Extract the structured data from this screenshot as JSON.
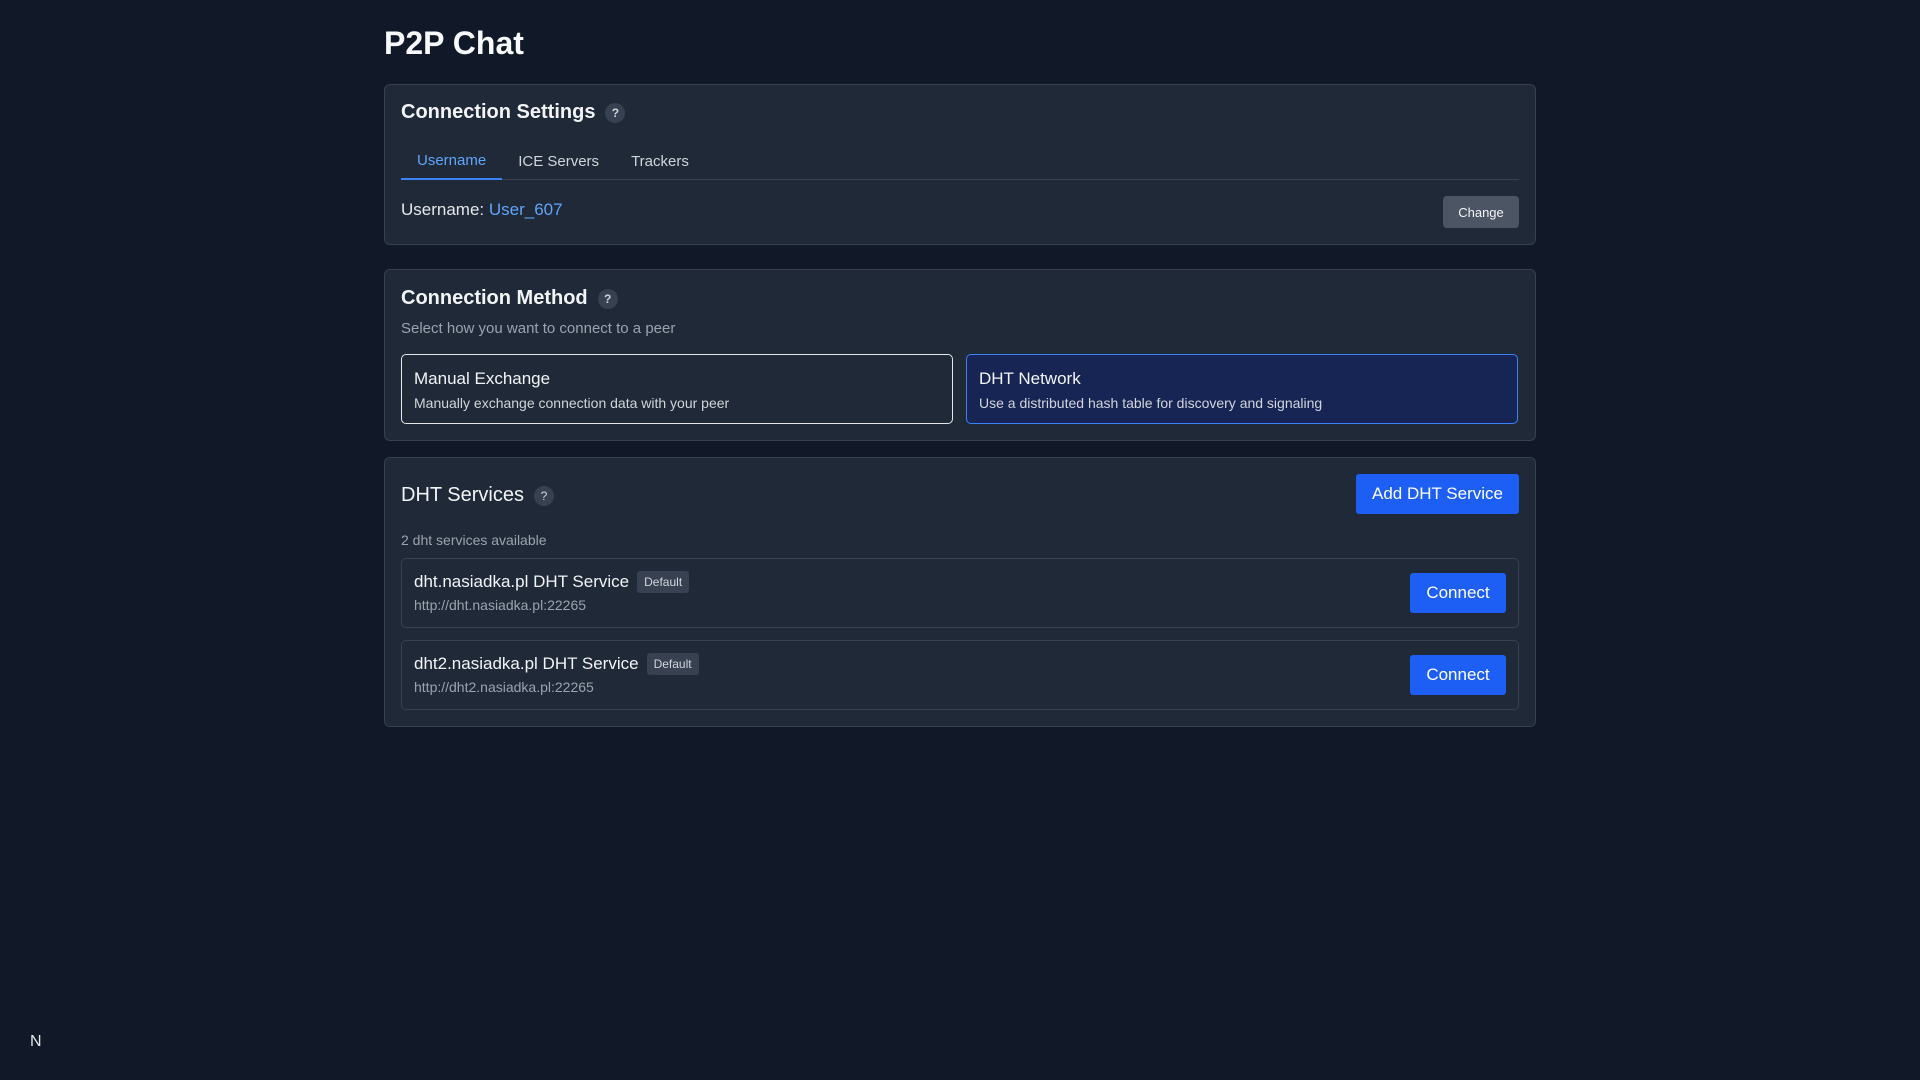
{
  "app": {
    "title": "P2P Chat"
  },
  "settings": {
    "title": "Connection Settings",
    "help": "?",
    "tabs": [
      {
        "label": "Username"
      },
      {
        "label": "ICE Servers"
      },
      {
        "label": "Trackers"
      }
    ],
    "username_label": "Username:",
    "username_value": "User_607",
    "change_label": "Change"
  },
  "method": {
    "title": "Connection Method",
    "help": "?",
    "subtitle": "Select how you want to connect to a peer",
    "options": [
      {
        "title": "Manual Exchange",
        "desc": "Manually exchange connection data with your peer"
      },
      {
        "title": "DHT Network",
        "desc": "Use a distributed hash table for discovery and signaling"
      }
    ]
  },
  "dht": {
    "title": "DHT Services",
    "help": "?",
    "add_label": "Add DHT Service",
    "count_text": "2 dht services available",
    "services": [
      {
        "name": "dht.nasiadka.pl DHT Service",
        "badge": "Default",
        "url": "http://dht.nasiadka.pl:22265",
        "connect": "Connect"
      },
      {
        "name": "dht2.nasiadka.pl DHT Service",
        "badge": "Default",
        "url": "http://dht2.nasiadka.pl:22265",
        "connect": "Connect"
      }
    ]
  },
  "footer": {
    "logo": "N"
  },
  "colors": {
    "background": "#111827",
    "card": "#1f2937",
    "accent": "#1d5ff5",
    "link": "#60a5fa"
  }
}
